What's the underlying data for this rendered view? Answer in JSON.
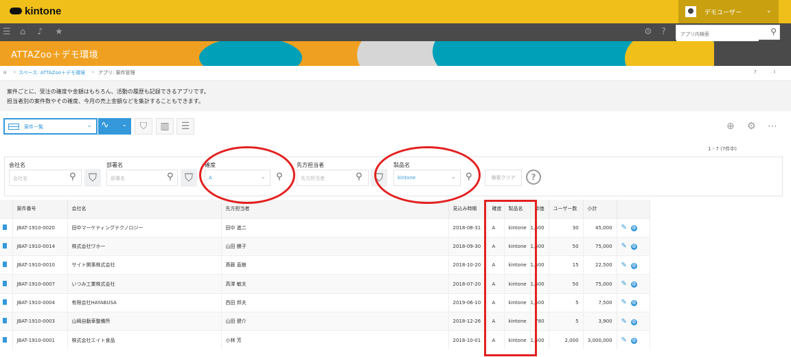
{
  "header": {
    "logo": "kintone",
    "user_name": "デモユーザー"
  },
  "nav": {
    "search_placeholder": "アプリ内検索"
  },
  "banner": {
    "title": "ATTAZoo＋デモ環境"
  },
  "breadcrumb": {
    "space": "スペース: ATTAZoo＋デモ環境",
    "app": "アプリ: 案件管理",
    "right1": "?",
    "right2": "i"
  },
  "description": {
    "line1": "案件ごとに、受注の確度や金額はもちろん、活動の履歴も記録できるアプリです。",
    "line2": "担当者別の案件数やその確度、今月の売上金額などを集計することもできます。"
  },
  "toolbar": {
    "view_label": "案件一覧",
    "record_count": "1 - 7 (7件中)"
  },
  "filters": {
    "company_label": "会社名",
    "company_placeholder": "会社名",
    "department_label": "部署名",
    "department_placeholder": "部署名",
    "accuracy_label": "確度",
    "accuracy_value": "A",
    "contact_label": "先方担当者",
    "contact_placeholder": "先方担当者",
    "product_label": "製品名",
    "product_value": "kintone",
    "clear_label": "検索クリア",
    "help": "?"
  },
  "table": {
    "columns": [
      "",
      "案件番号",
      "会社名",
      "先方担当者",
      "見込み時期",
      "確度",
      "製品名",
      "単価",
      "ユーザー数",
      "小計",
      ""
    ],
    "rows": [
      {
        "id": "JBAT-1910-0020",
        "company": "田中マーケティングテクノロジー",
        "contact": "田中 進二",
        "date": "2018-08-31",
        "accuracy": "A",
        "product": "kintone",
        "price": "1,500",
        "users": "30",
        "subtotal": "45,000"
      },
      {
        "id": "JBAT-1910-0014",
        "company": "株式会社ワホー",
        "contact": "山田 勝子",
        "date": "2018-09-30",
        "accuracy": "A",
        "product": "kintone",
        "price": "1,500",
        "users": "50",
        "subtotal": "75,000"
      },
      {
        "id": "JBAT-1910-0010",
        "company": "サイト関事株式会社",
        "contact": "斎藤 直樹",
        "date": "2018-10-20",
        "accuracy": "A",
        "product": "kintone",
        "price": "1,500",
        "users": "15",
        "subtotal": "22,500"
      },
      {
        "id": "JBAT-1910-0007",
        "company": "いつみ工業株式会社",
        "contact": "高澤 敏夫",
        "date": "2018-07-20",
        "accuracy": "A",
        "product": "kintone",
        "price": "1,500",
        "users": "50",
        "subtotal": "75,000"
      },
      {
        "id": "JBAT-1910-0004",
        "company": "有限会社HAYABUSA",
        "contact": "西田 邦夫",
        "date": "2019-06-10",
        "accuracy": "A",
        "product": "kintone",
        "price": "1,500",
        "users": "5",
        "subtotal": "7,500"
      },
      {
        "id": "JBAT-1910-0003",
        "company": "山崎自動車整備所",
        "contact": "山田 健介",
        "date": "2018-12-26",
        "accuracy": "A",
        "product": "kintone",
        "price": "780",
        "users": "5",
        "subtotal": "3,900"
      },
      {
        "id": "JBAT-1910-0001",
        "company": "株式会社エイト食品",
        "contact": "小林 芳",
        "date": "2018-10-01",
        "accuracy": "A",
        "product": "kintone",
        "price": "1,500",
        "users": "2,000",
        "subtotal": "3,000,000"
      }
    ]
  },
  "colors": {
    "header_yellow": "#f0bf1a",
    "nav_dark": "#4a4a4a",
    "accent_blue": "#3498db",
    "annotation_red": "#e32020"
  }
}
